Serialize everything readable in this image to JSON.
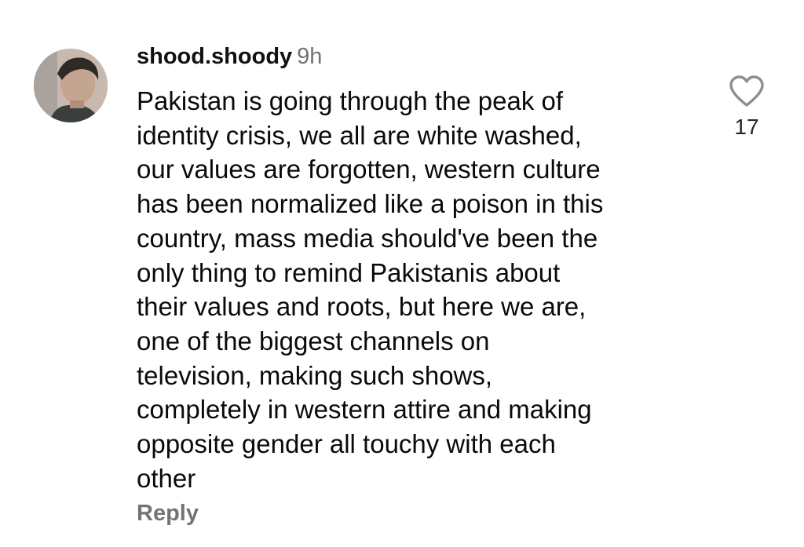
{
  "comment": {
    "username": "shood.shoody",
    "timestamp": "9h",
    "text_lines": [
      "Pakistan is going through the peak of",
      "identity crisis, we all are white washed,",
      "our values are forgotten, western culture",
      "has been normalized like a poison in this",
      "country, mass media should've been the",
      "only thing to remind Pakistanis about",
      "their values and roots, but here we are,",
      "one of the biggest channels on",
      "television, making such shows,",
      "completely in western attire and making",
      "opposite gender all touchy with each",
      "other"
    ],
    "reply_label": "Reply",
    "like_count": "17",
    "like_icon": "heart-outline-icon"
  },
  "colors": {
    "background": "#ffffff",
    "text": "#0a0a0a",
    "muted": "#737373"
  }
}
